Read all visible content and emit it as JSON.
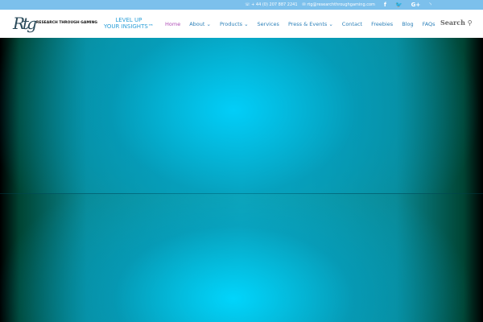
{
  "topbar": {
    "phone": "+ 44 (0) 207 887 2241",
    "email": "rtg@researchthroughgaming.com",
    "social": [
      "facebook-icon",
      "twitter-icon",
      "google-plus-icon",
      "rss-icon"
    ]
  },
  "logo": {
    "mark": "Rtg",
    "words": "RESEARCH THROUGH GAMING",
    "tagline1": "LEVEL UP",
    "tagline2": "YOUR INSIGHTS™"
  },
  "menu": [
    "Home",
    "About ⌄",
    "Products ⌄",
    "Services",
    "Press & Events ⌄",
    "Contact",
    "Freebies",
    "Blog",
    "FAQs"
  ],
  "search": {
    "label": "Search",
    "icon": "⚲"
  },
  "colors": {
    "topbar": "#7cc0ec",
    "link": "#2a7fb8",
    "active": "#b04fb8"
  }
}
